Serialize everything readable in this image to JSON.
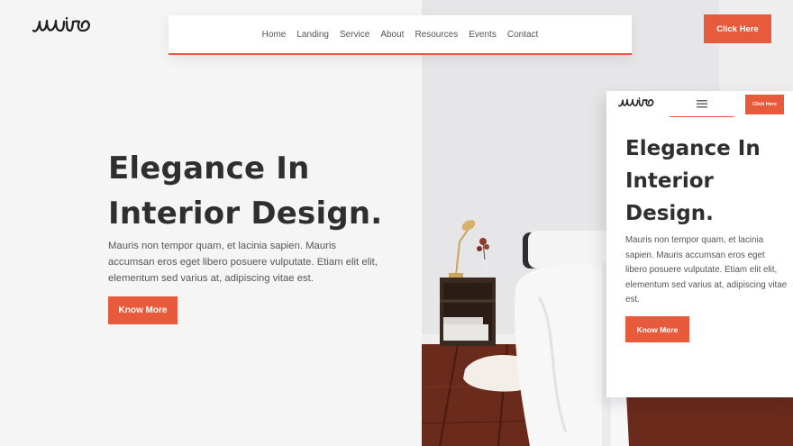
{
  "brand": {
    "logo_text": "uuire"
  },
  "nav": {
    "items": [
      {
        "label": "Home"
      },
      {
        "label": "Landing"
      },
      {
        "label": "Service"
      },
      {
        "label": "About"
      },
      {
        "label": "Resources"
      },
      {
        "label": "Events"
      },
      {
        "label": "Contact"
      }
    ],
    "cta_label": "Click Here"
  },
  "hero": {
    "title_line1": "Elegance In",
    "title_line2": "Interior Design.",
    "text": "Mauris non tempor quam, et lacinia sapien. Mauris accumsan eros eget libero posuere vulputate. Etiam elit elit, elementum sed varius at, adipiscing vitae est.",
    "button_label": "Know More"
  },
  "mobile": {
    "menu_icon": "hamburger-icon",
    "cta_label": "Click Here",
    "title": "Elegance In Interior Design.",
    "text": "Mauris non tempor quam, et lacinia sapien. Mauris accumsan eros eget libero posuere vulputate. Etiam elit elit, elementum sed varius at, adipiscing vitae est.",
    "button_label": "Know More"
  },
  "colors": {
    "accent": "#e85a3c",
    "text_dark": "#2f2f2f",
    "text_body": "#555555"
  }
}
